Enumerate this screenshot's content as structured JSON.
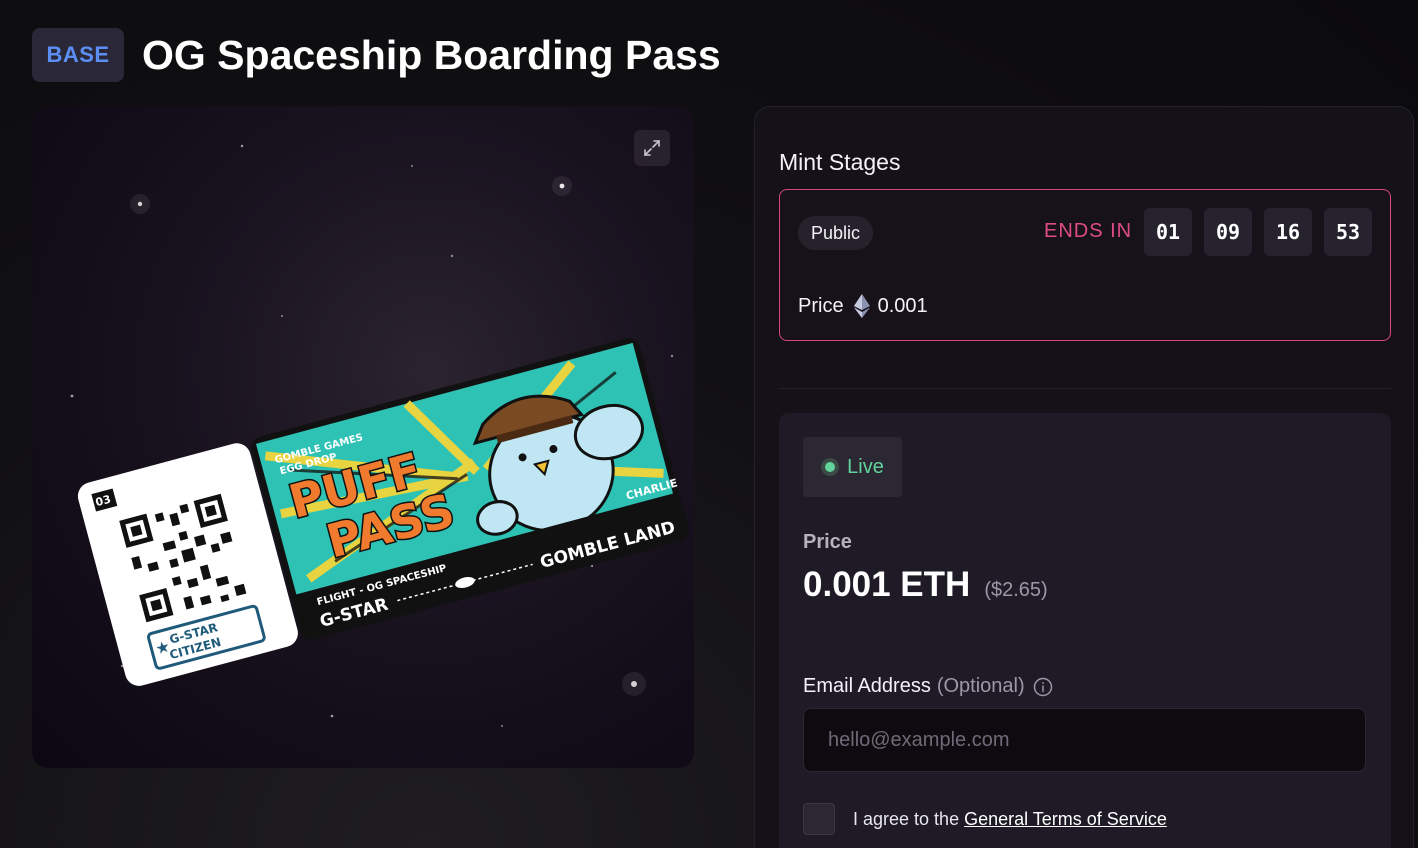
{
  "header": {
    "chain_badge": "BASE",
    "title": "OG Spaceship Boarding Pass"
  },
  "media": {
    "expand_icon": "expand-icon",
    "ticket": {
      "number": "03",
      "brand_line1": "GOMBLE GAMES",
      "brand_line2": "EGG DROP",
      "title_line1": "PUFF",
      "title_line2": "PASS",
      "name": "CHARLIE",
      "flight": "FLIGHT - OG SPACESHIP",
      "from": "G-STAR",
      "to": "GOMBLE LAND",
      "stamp_line1": "G-STAR",
      "stamp_line2": "CITIZEN"
    }
  },
  "mint_stages": {
    "title": "Mint Stages",
    "stage": {
      "name": "Public",
      "ends_label": "ENDS IN",
      "countdown": [
        "01",
        "09",
        "16",
        "53"
      ],
      "price_label": "Price",
      "price_icon": "ethereum-icon",
      "price_value": "0.001"
    }
  },
  "mint": {
    "status": "Live",
    "price_label": "Price",
    "price_value": "0.001 ETH",
    "price_usd": "($2.65)",
    "email_label": "Email Address",
    "email_optional": "(Optional)",
    "email_placeholder": "hello@example.com",
    "terms_prefix": "I agree to the ",
    "terms_link": "General Terms of Service"
  },
  "colors": {
    "accent_pink": "#dd4c86",
    "live_green": "#62d39b",
    "base_blue": "#5b8ff5"
  }
}
